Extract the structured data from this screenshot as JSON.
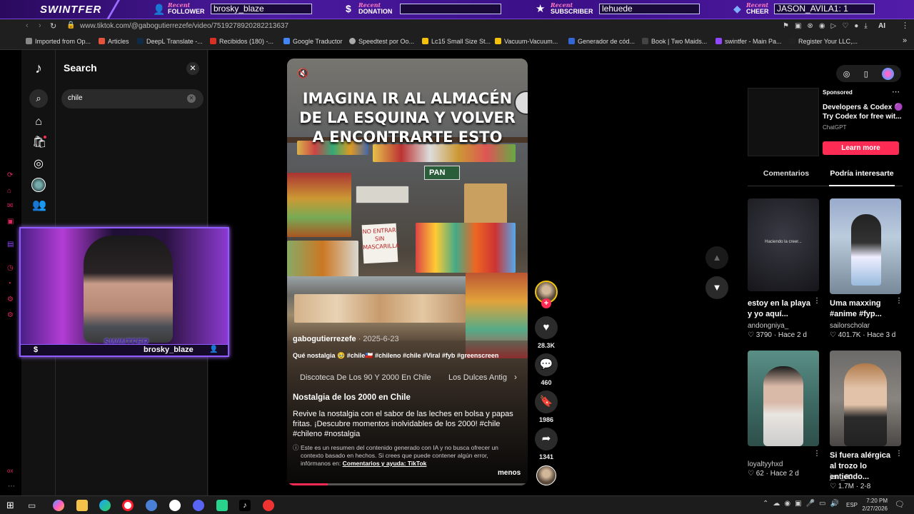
{
  "overlay": {
    "brand": "SWINTFER",
    "follower": {
      "tag": "Recent",
      "label": "FOLLOWER",
      "value": "brosky_blaze"
    },
    "donation": {
      "tag": "Recent",
      "label": "DONATION",
      "value": ""
    },
    "subscriber": {
      "tag": "Recent",
      "label": "SUBSCRIBER",
      "value": "lehuede"
    },
    "cheer": {
      "tag": "Recent",
      "label": "CHEER",
      "value": "JASON_AVILA1: 1"
    },
    "webcam_name": "brosky_blaze",
    "webcam_brand": "SWINTFER",
    "webcam_symbol": "$"
  },
  "browser": {
    "url": "www.tiktok.com/@gabogutierrezefe/video/7519278920282213637",
    "ai_label": "AI",
    "bookmarks": [
      "Imported from Op...",
      "Articles",
      "DeepL Translate -...",
      "Recibidos (180) -...",
      "Google Traductor",
      "Speedtest por Oo...",
      "Lc15 Small Size St...",
      "Vacuum-Vacuum...",
      "Generador de cód...",
      "Book | Two Maids...",
      "swintfer - Main Pa...",
      "Register Your LLC,..."
    ]
  },
  "search": {
    "title": "Search",
    "value": "chile"
  },
  "video": {
    "overlay_text": [
      "IMAGINA IR AL ALMACÉN",
      "DE LA ESQUINA Y VOLVER",
      "A ENCONTRARTE ESTO"
    ],
    "sign_text": [
      "NO ENTRAR",
      "SIN",
      "MASCARILLA"
    ],
    "pan_sign": "PAN",
    "author": "gabogutierrezefe",
    "date": "· 2025-6-23",
    "caption": "Qué nostalgia 🥹 #chile🇨🇱 #chileno #chile #Viral #fyb #greenscreen",
    "related": [
      "Discoteca De Los 90 Y 2000 En Chile",
      "Los Dulces Antig"
    ],
    "summary_title": "Nostalgia de los 2000 en Chile",
    "summary_body": "Revive la nostalgia con el sabor de las leches en bolsa y papas fritas. ¡Descubre momentos inolvidables de los 2000! #chile #chileno #nostalgia",
    "disclaimer": "Este es un resumen del contenido generado con IA y no busca ofrecer un contexto basado en hechos. Si crees que puede contener algún error, infórmanos en:",
    "disclaimer_link": "Comentarios y ayuda: TikTok",
    "less": "menos",
    "progress": 0.17
  },
  "actions": {
    "likes": "28.3K",
    "comments": "460",
    "saves": "1986",
    "shares": "1341"
  },
  "ad": {
    "badge": "Sponsored",
    "title": "Developers & Codex 🟣 Try Codex for free wit...",
    "advertiser": "ChatGPT",
    "cta": "Learn more"
  },
  "tabs": {
    "comments": "Comentarios",
    "suggested": "Podría interesarte"
  },
  "suggestions": [
    {
      "title": "estoy en la playa y yo aquí...",
      "thumb_text": "Haciendo la creer...",
      "author": "andongniya_",
      "likes": "3790",
      "ago": "Hace 2 d"
    },
    {
      "title": "Uma maxxing #anime #fyp...",
      "author": "sailorscholar",
      "likes": "401.7K",
      "ago": "Hace 3 d"
    },
    {
      "title": "",
      "author": "loyaltyyhxd",
      "likes": "62",
      "ago": "Hace 2 d"
    },
    {
      "title": "Si fuera alérgica al trozo lo entiendo...",
      "author": "jeni_00",
      "likes": "1.7M",
      "ago": "2-8"
    }
  ],
  "taskbar": {
    "lang": "ESP",
    "time": "7:20 PM",
    "date": "2/27/2026"
  },
  "colors": {
    "tiktok_red": "#fe2c55",
    "overlay_purple": "#4b1aa0"
  }
}
